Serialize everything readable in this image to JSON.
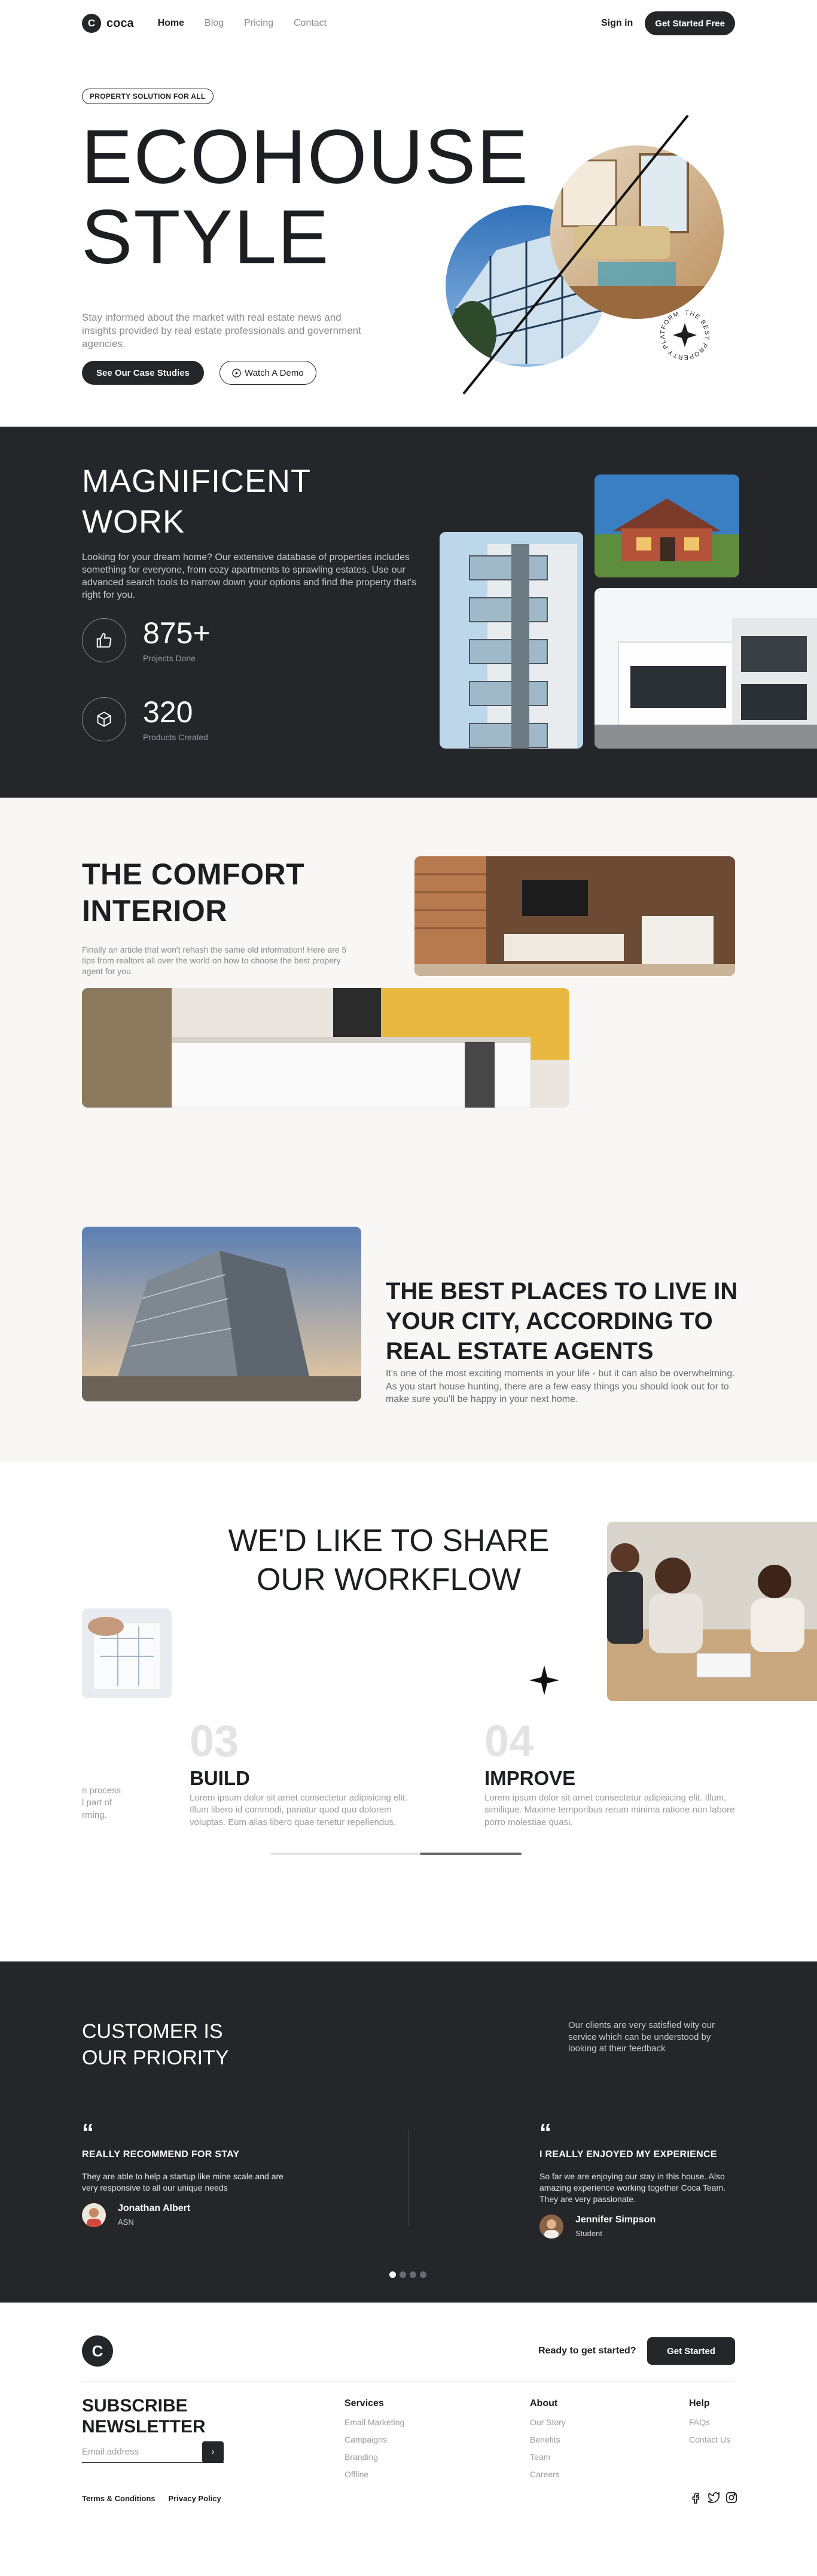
{
  "nav": {
    "logo_text": "coca",
    "logo_letter": "C",
    "menu": [
      "Home",
      "Blog",
      "Pricing",
      "Contact"
    ],
    "signin": "Sign in",
    "cta": "Get Started Free"
  },
  "hero": {
    "badge": "PROPERTY SOLUTION FOR ALL",
    "title_line1": "ECOHOUSE",
    "title_line2": "STYLE",
    "description": "Stay informed about the market with real estate news and insights provided by real estate professionals and government agencies.",
    "primary_button": "See Our Case Studies",
    "secondary_button": "Watch A Demo",
    "round_text": "THE BEST PROPERTY PLATFORM"
  },
  "magnificent": {
    "title_line1": "MAGNIFICENT",
    "title_line2": "WORK",
    "description": "Looking for your dream home? Our extensive database of properties includes something for everyone, from cozy apartments to sprawling estates. Use our advanced search tools to narrow down your options and find the property that's right for you.",
    "stats": [
      {
        "value": "875+",
        "label": "Projects Done"
      },
      {
        "value": "320",
        "label": "Products Created"
      }
    ]
  },
  "comfort": {
    "title_line1": "THE COMFORT",
    "title_line2": "INTERIOR",
    "description": "Finally an article that won't rehash the same old information! Here are 5 tips from realtors all over the world on how to choose the best propery agent for you."
  },
  "best_places": {
    "title": "THE BEST PLACES TO LIVE IN YOUR CITY, ACCORDING TO REAL ESTATE AGENTS",
    "description": "It's one of the most exciting moments in your life - but it can also be overwhelming. As you start house hunting, there are a few easy things you should look out for to make sure you'll be happy in your next home."
  },
  "workflow": {
    "title_line1": "WE'D LIKE TO SHARE",
    "title_line2": "OUR WORKFLOW",
    "partial_step_text": [
      "n process",
      "l part of",
      "rming."
    ],
    "steps": [
      {
        "number": "03",
        "title": "BUILD",
        "text": "Lorem ipsum dolor sit amet consectetur adipisicing elit. Illum libero id commodi, pariatur quod quo dolorem voluptas. Eum alias libero quae tenetur repellendus."
      },
      {
        "number": "04",
        "title": "IMPROVE",
        "text": "Lorem ipsum dolor sit amet consectetur adipisicing elit. Illum, similique. Maxime temporibus rerum minima ratione non labore porro molestiae quasi."
      }
    ]
  },
  "customers": {
    "title_line1": "CUSTOMER IS",
    "title_line2": "OUR PRIORITY",
    "intro": "Our clients are very satisfied wity our service which can be understood by looking at their feedback",
    "testimonials": [
      {
        "quote_mark": "“",
        "heading": "REALLY RECOMMEND FOR STAY",
        "text": "They are able to help a startup like mine scale and are very responsive to all our unique needs",
        "name": "Jonathan Albert",
        "role": "ASN"
      },
      {
        "quote_mark": "“",
        "heading": "I REALLY ENJOYED MY EXPERIENCE",
        "text": "So far we are enjoying our stay in this house. Also amazing experience working together Coca Team. They are very passionate.",
        "name": "Jennifer Simpson",
        "role": "Student"
      }
    ]
  },
  "footer": {
    "logo_letter": "C",
    "ready": "Ready to get started?",
    "cta": "Get Started",
    "subscribe_line1": "SUBSCRIBE",
    "subscribe_line2": "NEWSLETTER",
    "email_placeholder": "Email address",
    "email_button": "›",
    "columns": [
      {
        "title": "Services",
        "links": [
          "Email Marketing",
          "Campaigns",
          "Branding",
          "Offline"
        ]
      },
      {
        "title": "About",
        "links": [
          "Our Story",
          "Benefits",
          "Team",
          "Careers"
        ]
      },
      {
        "title": "Help",
        "links": [
          "FAQs",
          "Contact Us"
        ]
      }
    ],
    "legal": [
      "Terms & Conditions",
      "Privacy Policy"
    ]
  },
  "colors": {
    "dark": "#25262a",
    "cream": "#f9f7f5",
    "muted": "#8a8a8f"
  }
}
